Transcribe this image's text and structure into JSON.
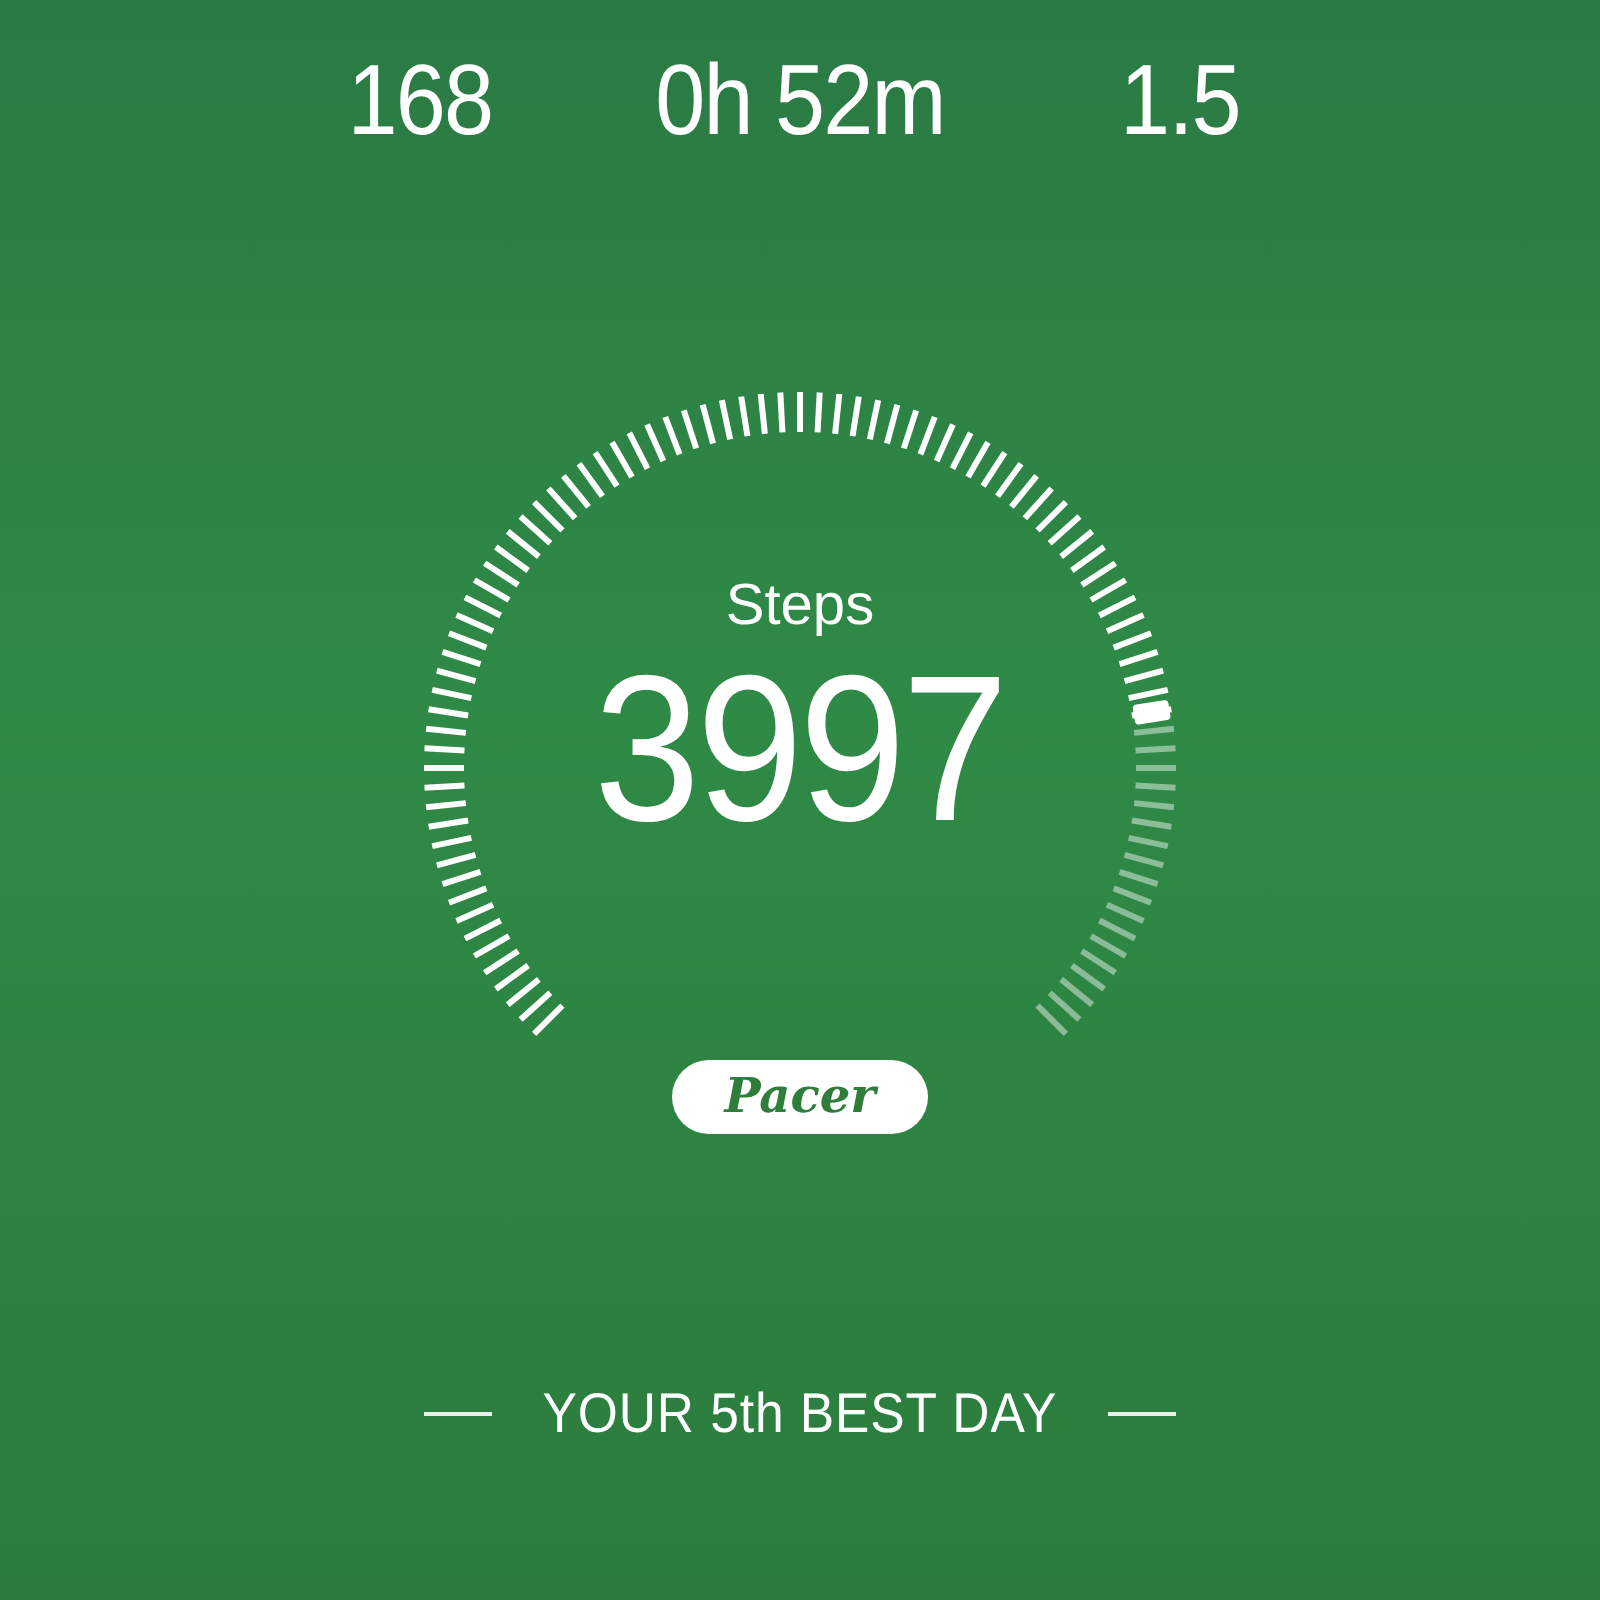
{
  "stats": [
    {
      "value": "168"
    },
    {
      "value": "0h 52m"
    },
    {
      "value": "1.5"
    }
  ],
  "gauge": {
    "label": "Steps",
    "value": "3997"
  },
  "logo": {
    "text": "Pacer"
  },
  "footer": {
    "text": "YOUR 5th BEST DAY"
  }
}
